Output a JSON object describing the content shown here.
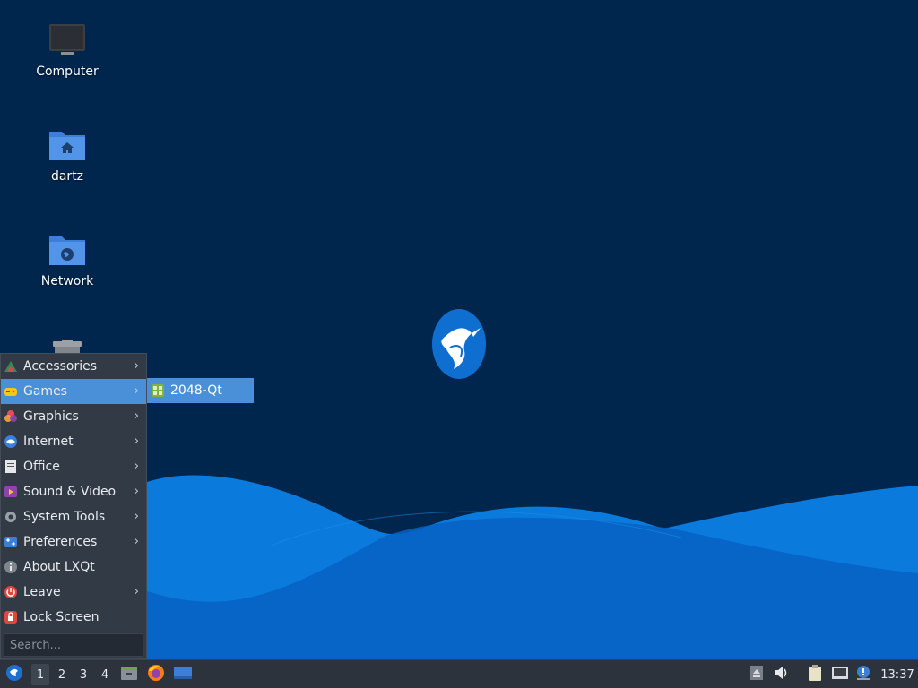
{
  "desktop": {
    "icons": [
      {
        "name": "Computer",
        "icon": "computer-icon"
      },
      {
        "name": "dartz",
        "icon": "home-folder-icon"
      },
      {
        "name": "Network",
        "icon": "network-folder-icon"
      },
      {
        "name": "",
        "icon": "trash-icon"
      }
    ],
    "wallpaper": {
      "background": "#01264d",
      "wave_light": "#0a7bdc",
      "wave_dark": "#0762c3",
      "logo": "hummingbird-logo"
    }
  },
  "start_menu": {
    "items": [
      {
        "label": "Accessories",
        "icon": "accessories-icon",
        "has_submenu": true
      },
      {
        "label": "Games",
        "icon": "games-icon",
        "has_submenu": true,
        "active": true
      },
      {
        "label": "Graphics",
        "icon": "graphics-icon",
        "has_submenu": true
      },
      {
        "label": "Internet",
        "icon": "internet-icon",
        "has_submenu": true
      },
      {
        "label": "Office",
        "icon": "office-icon",
        "has_submenu": true
      },
      {
        "label": "Sound & Video",
        "icon": "sound-video-icon",
        "has_submenu": true
      },
      {
        "label": "System Tools",
        "icon": "system-tools-icon",
        "has_submenu": true
      },
      {
        "label": "Preferences",
        "icon": "preferences-icon",
        "has_submenu": true
      },
      {
        "label": "About LXQt",
        "icon": "info-icon",
        "has_submenu": false
      },
      {
        "label": "Leave",
        "icon": "power-icon",
        "has_submenu": true
      },
      {
        "label": "Lock Screen",
        "icon": "lock-icon",
        "has_submenu": false
      }
    ],
    "arrow_glyph": "›",
    "search_placeholder": "Search..."
  },
  "submenu": {
    "items": [
      {
        "label": "2048-Qt",
        "icon": "2048-qt-icon"
      }
    ]
  },
  "taskbar": {
    "desktops": [
      "1",
      "2",
      "3",
      "4"
    ],
    "active_desktop": "1",
    "launchers": [
      "lxqt-start-icon",
      "file-manager-icon",
      "firefox-icon",
      "show-desktop-icon"
    ],
    "tray": [
      "eject-icon",
      "volume-icon",
      "clipboard-icon",
      "network-icon",
      "update-notifier-icon"
    ],
    "clock": "13:37",
    "accent": "#4a90d9"
  }
}
